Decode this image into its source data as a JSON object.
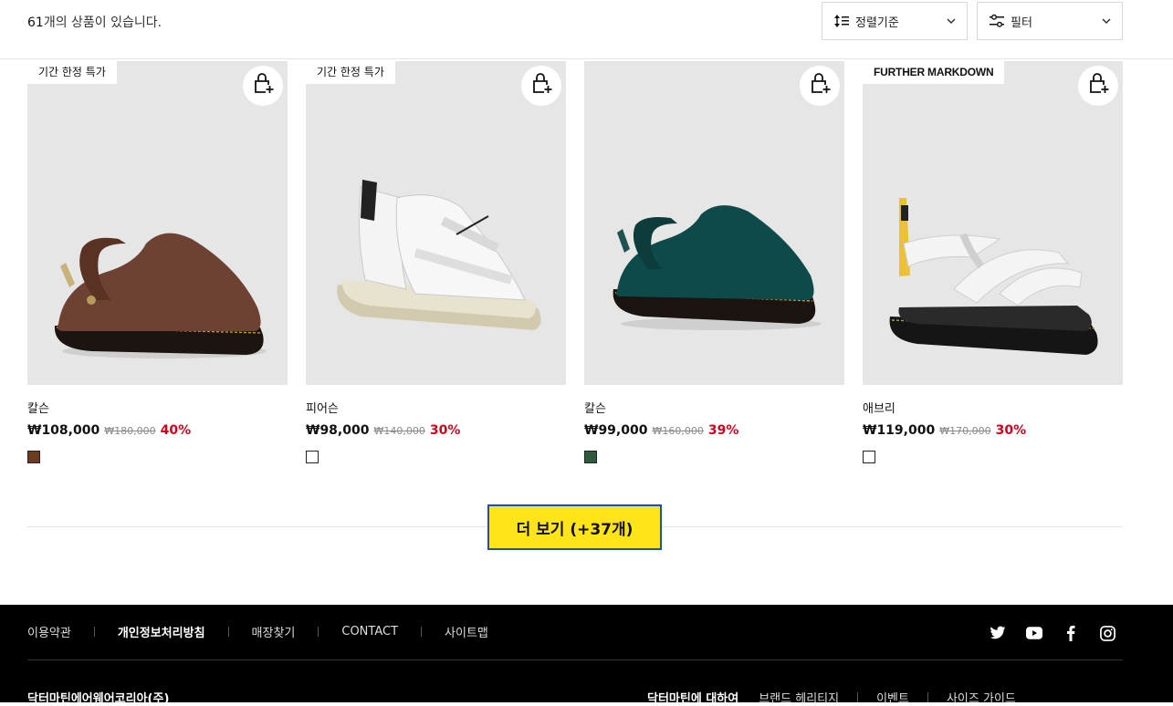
{
  "result": {
    "count": "61",
    "suffix": "개의 상품이 있습니다."
  },
  "sort": {
    "label": "정렬기준"
  },
  "filter": {
    "label": "필터"
  },
  "products": [
    {
      "badge": "기간 한정 특가",
      "name": "칼슨",
      "price": "₩108,000",
      "original_price": "₩180,000",
      "discount": "40%",
      "swatch_color": "#6b3a22",
      "shoe_color": "#6e4232"
    },
    {
      "badge": "기간 한정 특가",
      "name": "피어슨",
      "price": "₩98,000",
      "original_price": "₩140,000",
      "discount": "30%",
      "swatch_color": "#ffffff",
      "shoe_color": "#f2f2f2"
    },
    {
      "badge": "",
      "name": "칼슨",
      "price": "₩99,000",
      "original_price": "₩160,000",
      "discount": "39%",
      "swatch_color": "#2e5a3e",
      "shoe_color": "#0f4a4a"
    },
    {
      "badge": "FURTHER MARKDOWN",
      "name": "애브리",
      "price": "₩119,000",
      "original_price": "₩170,000",
      "discount": "30%",
      "swatch_color": "#ffffff",
      "shoe_color": "#f4f4f4"
    }
  ],
  "load_more": {
    "label": "더 보기 (+37개)"
  },
  "footer": {
    "links": [
      "이용약관",
      "개인정보처리방침",
      "매장찾기",
      "CONTACT",
      "사이트맵"
    ],
    "company": "닥터마틴에어웨어코리아(주)",
    "links2": [
      "닥터마틴에 대하여",
      "브랜드 헤리티지",
      "이벤트",
      "사이즈 가이드"
    ]
  },
  "colors": {
    "accent_yellow": "#ffe419",
    "sale_red": "#d0021b",
    "focus_blue": "#1a4fc4"
  }
}
